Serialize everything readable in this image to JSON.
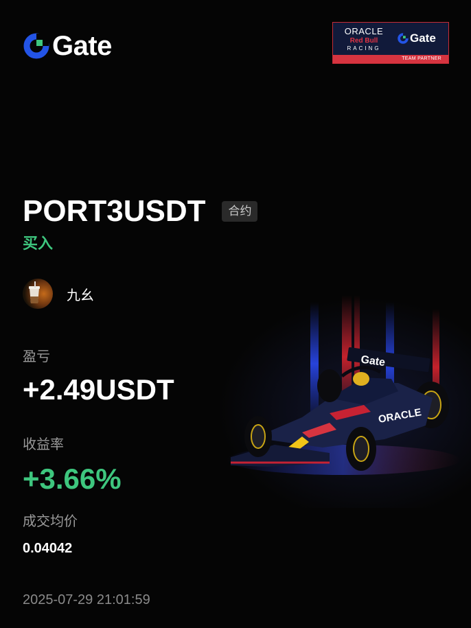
{
  "brand": {
    "logo_text": "Gate",
    "logo_color": "#2354e6",
    "accent_green": "#3ec67e"
  },
  "partner_badge": {
    "oracle": "ORACLE",
    "redbull": "Red Bull",
    "racing": "RACING",
    "gate": "Gate",
    "footer": "TEAM PARTNER"
  },
  "position": {
    "symbol": "PORT3USDT",
    "type_tag": "合约",
    "side": "买入"
  },
  "user": {
    "name": "九幺"
  },
  "pnl": {
    "label": "盈亏",
    "value": "+2.49USDT"
  },
  "roi": {
    "label": "收益率",
    "value": "+3.66%"
  },
  "avg_price": {
    "label": "成交均价",
    "value": "0.04042"
  },
  "timestamp": "2025-07-29 21:01:59",
  "car_livery": {
    "wing_text": "Gate",
    "sidepod_text": "ORACLE"
  }
}
